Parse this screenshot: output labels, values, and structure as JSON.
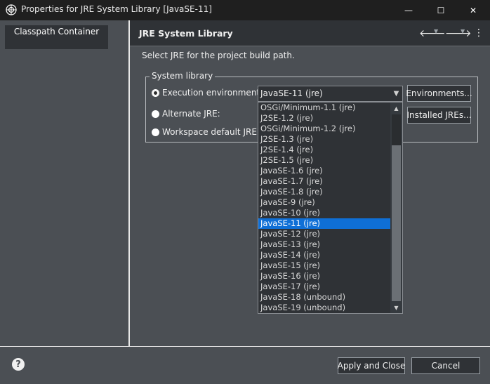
{
  "window": {
    "title": "Properties for JRE System Library [JavaSE-11]",
    "minimize_glyph": "—",
    "maximize_glyph": "☐",
    "close_glyph": "✕"
  },
  "nav": {
    "items": [
      {
        "label": "Classpath Container"
      }
    ]
  },
  "page": {
    "title": "JRE System Library",
    "description": "Select JRE for the project build path.",
    "back_icon": "🡐",
    "forward_icon": "🡒",
    "menu_icon": "⋮",
    "dropdown_glyph": "▼"
  },
  "system_library": {
    "label": "System library",
    "execution_environment": {
      "label": "Execution environment:",
      "selected": true,
      "value": "JavaSE-11 (jre)"
    },
    "alternate_jre": {
      "label": "Alternate JRE:",
      "selected": false
    },
    "workspace_default": {
      "label": "Workspace default JRE (jr",
      "selected": false
    },
    "environments_button": "Environments...",
    "installed_jres_button": "Installed JREs..."
  },
  "dropdown": {
    "options": [
      "OSGi/Minimum-1.1 (jre)",
      "J2SE-1.2 (jre)",
      "OSGi/Minimum-1.2 (jre)",
      "J2SE-1.3 (jre)",
      "J2SE-1.4 (jre)",
      "J2SE-1.5 (jre)",
      "JavaSE-1.6 (jre)",
      "JavaSE-1.7 (jre)",
      "JavaSE-1.8 (jre)",
      "JavaSE-9 (jre)",
      "JavaSE-10 (jre)",
      "JavaSE-11 (jre)",
      "JavaSE-12 (jre)",
      "JavaSE-13 (jre)",
      "JavaSE-14 (jre)",
      "JavaSE-15 (jre)",
      "JavaSE-16 (jre)",
      "JavaSE-17 (jre)",
      "JavaSE-18 (unbound)",
      "JavaSE-19 (unbound)"
    ],
    "selected_value": "JavaSE-11 (jre)",
    "scroll_up_glyph": "▲",
    "scroll_down_glyph": "▼"
  },
  "footer": {
    "help_glyph": "?",
    "apply_close_button": "Apply and Close",
    "cancel_button": "Cancel"
  },
  "colors": {
    "background": "#4b4f54",
    "panel_dark": "#2f3236",
    "titlebar": "#1f1f1f",
    "selection": "#0f6fd6"
  }
}
